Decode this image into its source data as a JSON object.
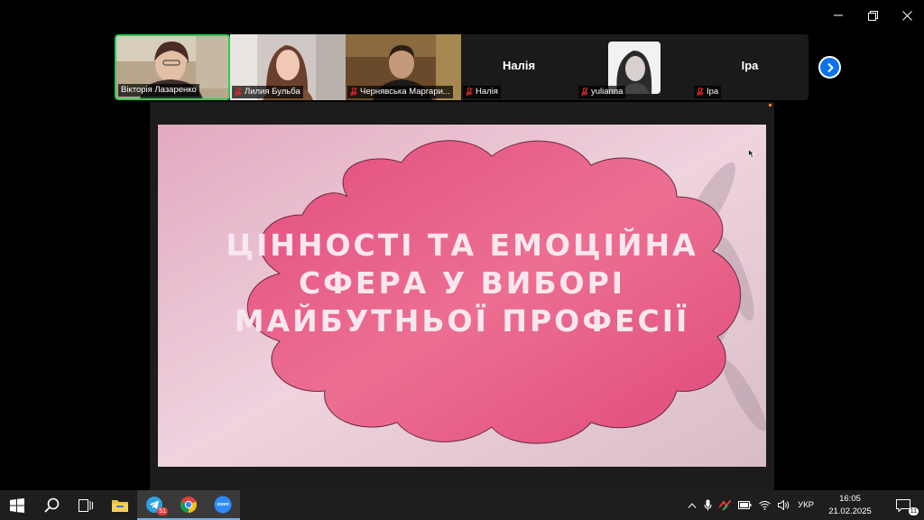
{
  "window_controls": {
    "minimize": "—",
    "restore": "❐",
    "close": "✕"
  },
  "participants": [
    {
      "name": "Вікторія Лазаренко",
      "type": "video",
      "active": true,
      "muted": false
    },
    {
      "name": "Лилия Бульба",
      "type": "video",
      "active": false,
      "muted": true
    },
    {
      "name": "Чернявська Маргари...",
      "type": "video",
      "active": false,
      "muted": true
    },
    {
      "name": "Налія",
      "display": "Налія",
      "type": "name",
      "active": false,
      "muted": true
    },
    {
      "name": "yulianna",
      "type": "photo",
      "active": false,
      "muted": true
    },
    {
      "name": "Іра",
      "display": "Іра",
      "type": "name",
      "active": false,
      "muted": true
    }
  ],
  "next_page_icon": "chevron-right-icon",
  "slide": {
    "title_lines": [
      "Цінності та емоційна",
      "сфера у виборі",
      "майбутньої професії"
    ],
    "colors": {
      "cloud": "#e75a86",
      "background": "#eac6d5"
    }
  },
  "taskbar": {
    "apps": [
      {
        "name": "start-icon"
      },
      {
        "name": "search-icon"
      },
      {
        "name": "task-view-icon"
      },
      {
        "name": "file-explorer-icon"
      },
      {
        "name": "telegram-icon",
        "badge": "51"
      },
      {
        "name": "chrome-icon"
      },
      {
        "name": "zoom-icon",
        "label": "zoom"
      }
    ],
    "language": "УКР",
    "time": "16:05",
    "date": "21.02.2025",
    "notifications": "11"
  }
}
